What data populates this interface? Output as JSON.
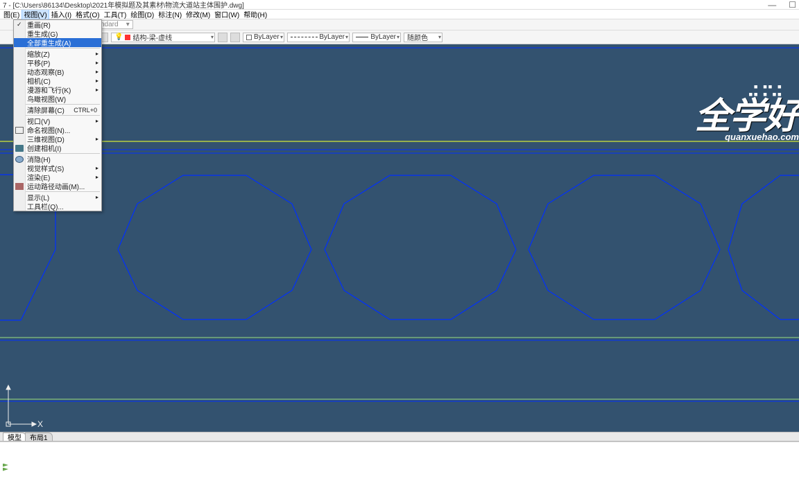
{
  "title": "7 - [C:\\Users\\86134\\Desktop\\2021年模拟题及其素材\\物流大道站主体围护.dwg]",
  "menubar": [
    "图(E)",
    "视图(V)",
    "插入(I)",
    "格式(O)",
    "工具(T)",
    "绘图(D)",
    "标注(N)",
    "修改(M)",
    "窗口(W)",
    "帮助(H)"
  ],
  "toolbar1": {
    "combo": "ndard"
  },
  "toolbar2": {
    "layer": "结构-梁-虚线",
    "color": "ByLayer",
    "linetype": "ByLayer",
    "lineweight": "ByLayer",
    "plotstyle": "随颜色"
  },
  "dropdown": {
    "items": [
      {
        "label": "重画(R)",
        "check": true
      },
      {
        "label": "重生成(G)"
      },
      {
        "label": "全部重生成(A)",
        "hl": true
      },
      {
        "sep": true
      },
      {
        "label": "缩放(Z)",
        "sub": true
      },
      {
        "label": "平移(P)",
        "sub": true
      },
      {
        "label": "动态观察(B)",
        "sub": true
      },
      {
        "label": "相机(C)",
        "sub": true
      },
      {
        "label": "漫游和飞行(K)",
        "sub": true
      },
      {
        "label": "鸟瞰视图(W)"
      },
      {
        "sep": true
      },
      {
        "label": "清除屏幕(C)",
        "shortcut": "CTRL+0"
      },
      {
        "sep": true
      },
      {
        "label": "视口(V)",
        "sub": true
      },
      {
        "label": "命名视图(N)...",
        "icon": "sq"
      },
      {
        "label": "三维视图(D)",
        "sub": true
      },
      {
        "label": "创建相机(I)",
        "icon": "cam"
      },
      {
        "sep": true
      },
      {
        "label": "消隐(H)",
        "icon": "globe"
      },
      {
        "label": "视觉样式(S)",
        "sub": true
      },
      {
        "label": "渲染(E)",
        "sub": true
      },
      {
        "label": "运动路径动画(M)...",
        "icon": "house"
      },
      {
        "sep": true
      },
      {
        "label": "显示(L)",
        "sub": true
      },
      {
        "label": "工具栏(Q)..."
      }
    ]
  },
  "tabs": [
    "模型",
    "布局1"
  ],
  "axis_label": "X",
  "watermark": {
    "big": "全学好",
    "small": "quanxuehao.com"
  }
}
